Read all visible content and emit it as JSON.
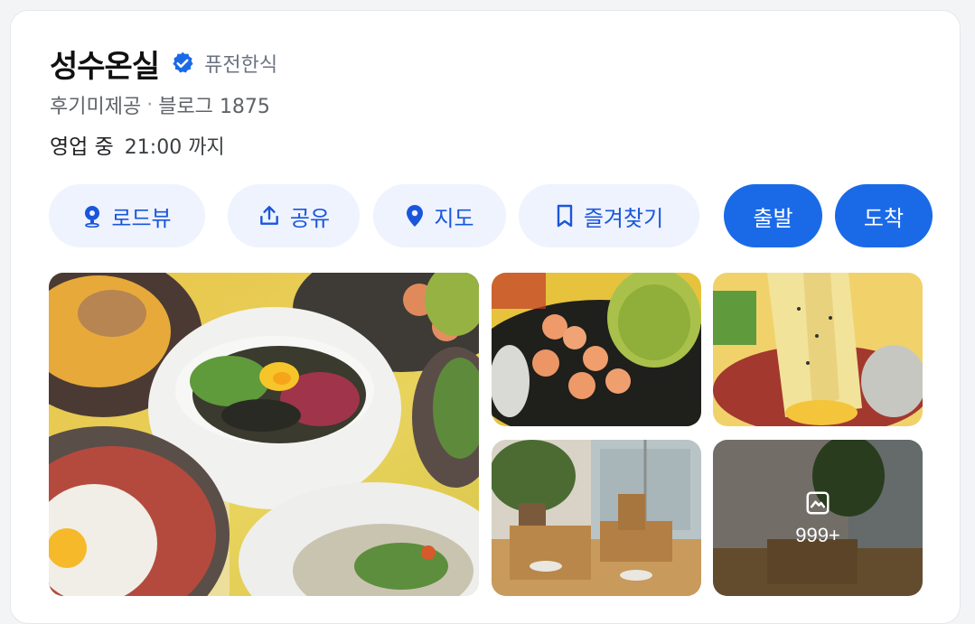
{
  "place": {
    "name": "성수온실",
    "category": "퓨전한식",
    "reviews_label": "후기미제공",
    "blog_label": "블로그",
    "blog_count": "1875",
    "status": "영업 중",
    "hours": "21:00 까지",
    "verified_icon": "verified-badge-icon"
  },
  "actions": [
    {
      "label": "로드뷰",
      "icon": "roadview-pin-icon"
    },
    {
      "label": "공유",
      "icon": "share-icon"
    },
    {
      "label": "지도",
      "icon": "map-pin-icon"
    },
    {
      "label": "즐겨찾기",
      "icon": "bookmark-icon"
    },
    {
      "label": "출발"
    },
    {
      "label": "도착"
    }
  ],
  "photos": {
    "more_count": "999+",
    "more_icon": "gallery-icon"
  },
  "colors": {
    "accent": "#1a6ae8",
    "accent_light_bg": "#eef3fd",
    "accent_text": "#1a56db"
  }
}
